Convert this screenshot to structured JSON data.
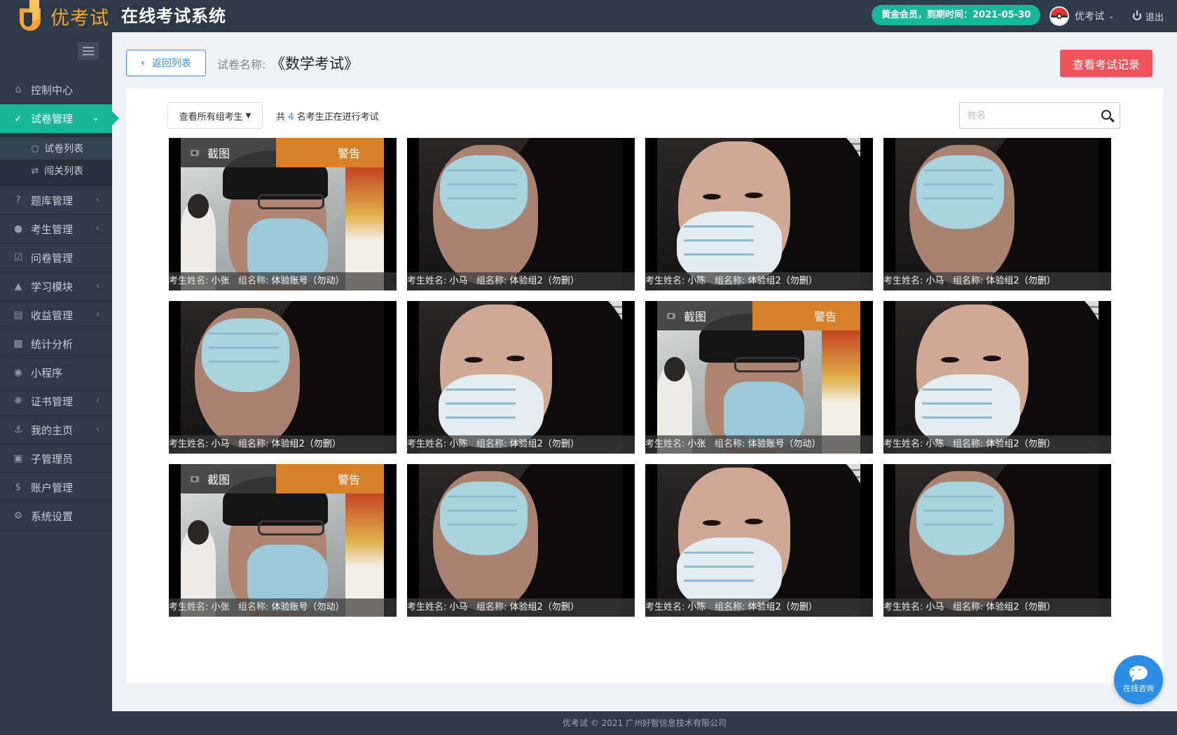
{
  "brand": {
    "logo_text": "优考试",
    "system_title": "在线考试系统"
  },
  "header": {
    "vip_badge": "黄金会员，到期时间：2021-05-30",
    "username": "优考试",
    "logout_label": "退出"
  },
  "sidebar": {
    "items": [
      {
        "label": "控制中心",
        "icon": "home-icon"
      },
      {
        "label": "试卷管理",
        "icon": "check-circle-icon",
        "active": true
      },
      {
        "label": "题库管理",
        "icon": "question-circle-icon"
      },
      {
        "label": "考生管理",
        "icon": "user-icon"
      },
      {
        "label": "问卷管理",
        "icon": "checkbox-icon"
      },
      {
        "label": "学习模块",
        "icon": "graduation-cap-icon"
      },
      {
        "label": "收益管理",
        "icon": "money-icon"
      },
      {
        "label": "统计分析",
        "icon": "bar-chart-icon"
      },
      {
        "label": "小程序",
        "icon": "wechat-icon"
      },
      {
        "label": "证书管理",
        "icon": "gear-icon"
      },
      {
        "label": "我的主页",
        "icon": "anchor-icon"
      },
      {
        "label": "子管理员",
        "icon": "lock-icon"
      },
      {
        "label": "账户管理",
        "icon": "dollar-icon"
      },
      {
        "label": "系统设置",
        "icon": "cog-icon"
      }
    ],
    "sub_items": [
      {
        "label": "试卷列表",
        "icon": "check-circle-icon"
      },
      {
        "label": "闯关列表",
        "icon": "shuffle-icon"
      }
    ]
  },
  "page": {
    "back_label": "返回列表",
    "paper_label": "试卷名称:",
    "paper_name": "《数学考试》",
    "record_button": "查看考试记录"
  },
  "filters": {
    "group_select": "查看所有组考生",
    "count_prefix": "共",
    "count_value": "4",
    "count_suffix": "名考生正在进行考试",
    "search_placeholder": "姓名"
  },
  "monitor": {
    "capture_label": "截图",
    "warning_label": "警告",
    "name_label": "考生姓名:",
    "group_label": "组名称:",
    "tiles": [
      {
        "name": "小张",
        "group": "体验账号（勿动）",
        "scene": "man",
        "capture": true
      },
      {
        "name": "小马",
        "group": "体验组2（勿删）",
        "scene": "woman-side"
      },
      {
        "name": "小陈",
        "group": "体验组2（勿删）",
        "scene": "woman-front"
      },
      {
        "name": "小马",
        "group": "体验组2（勿删）",
        "scene": "woman-side"
      },
      {
        "name": "小马",
        "group": "体验组2（勿删）",
        "scene": "woman-side"
      },
      {
        "name": "小陈",
        "group": "体验组2（勿删）",
        "scene": "woman-front"
      },
      {
        "name": "小张",
        "group": "体验账号（勿动）",
        "scene": "man",
        "capture": true
      },
      {
        "name": "小陈",
        "group": "体验组2（勿删）",
        "scene": "woman-front"
      },
      {
        "name": "小张",
        "group": "体验账号（勿动）",
        "scene": "man",
        "capture": true
      },
      {
        "name": "小马",
        "group": "体验组2（勿删）",
        "scene": "woman-side"
      },
      {
        "name": "小陈",
        "group": "体验组2（勿删）",
        "scene": "woman-front"
      },
      {
        "name": "小马",
        "group": "体验组2（勿删）",
        "scene": "woman-side"
      }
    ]
  },
  "footer": {
    "text": "优考试 © 2021 广州好智信息技术有限公司"
  },
  "chat": {
    "label": "在线咨询"
  },
  "colors": {
    "accent": "#18b69a",
    "primary": "#3c8de0",
    "danger": "#f0535b",
    "warning": "#d9812a",
    "sidebar_bg": "#2e3a48"
  }
}
